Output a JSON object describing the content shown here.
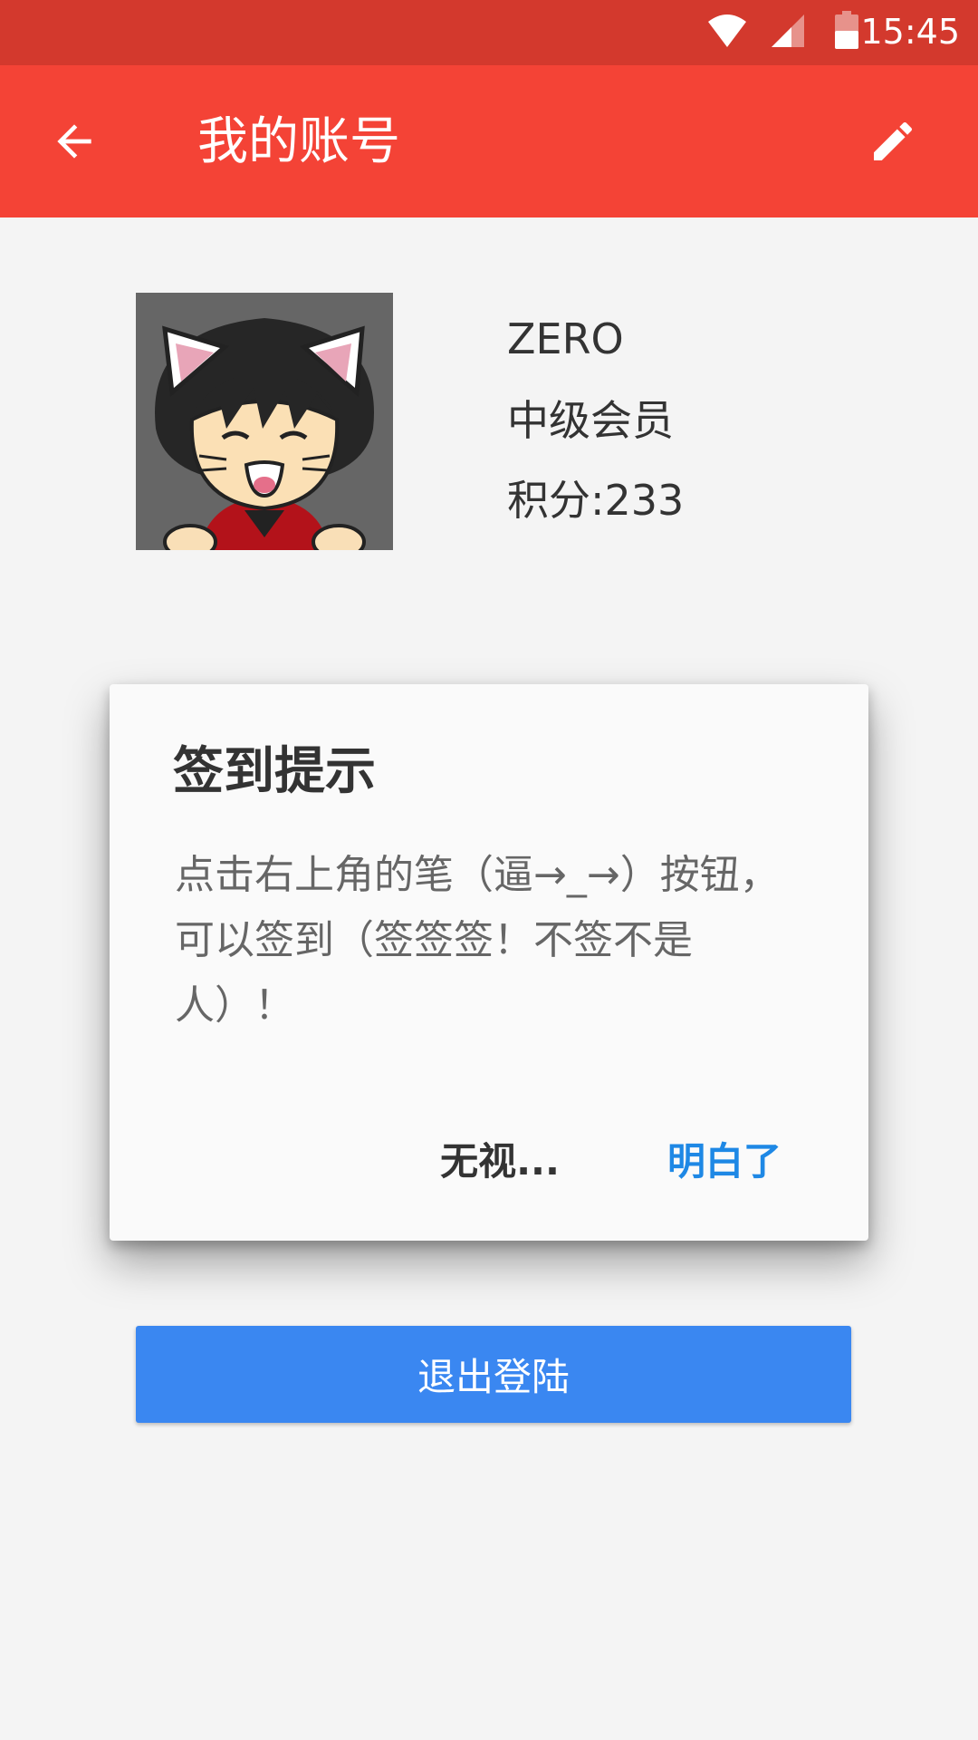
{
  "status_bar": {
    "time": "15:45",
    "icons": [
      "wifi-icon",
      "signal-icon",
      "battery-icon"
    ],
    "color": "#d3392d"
  },
  "app_bar": {
    "title": "我的账号",
    "back_icon": "arrow-back-icon",
    "edit_icon": "pencil-icon",
    "color": "#f44336"
  },
  "profile": {
    "name": "ZERO",
    "level": "中级会员",
    "points": "积分:233"
  },
  "dialog": {
    "title": "签到提示",
    "message": "点击右上角的笔（逼→_→）按钮，可以签到（签签签！不签不是人）！",
    "ignore_label": "无视...",
    "ok_label": "明白了",
    "ok_color": "#1e88e5"
  },
  "logout": {
    "label": "退出登陆",
    "color": "#3a87f1"
  }
}
